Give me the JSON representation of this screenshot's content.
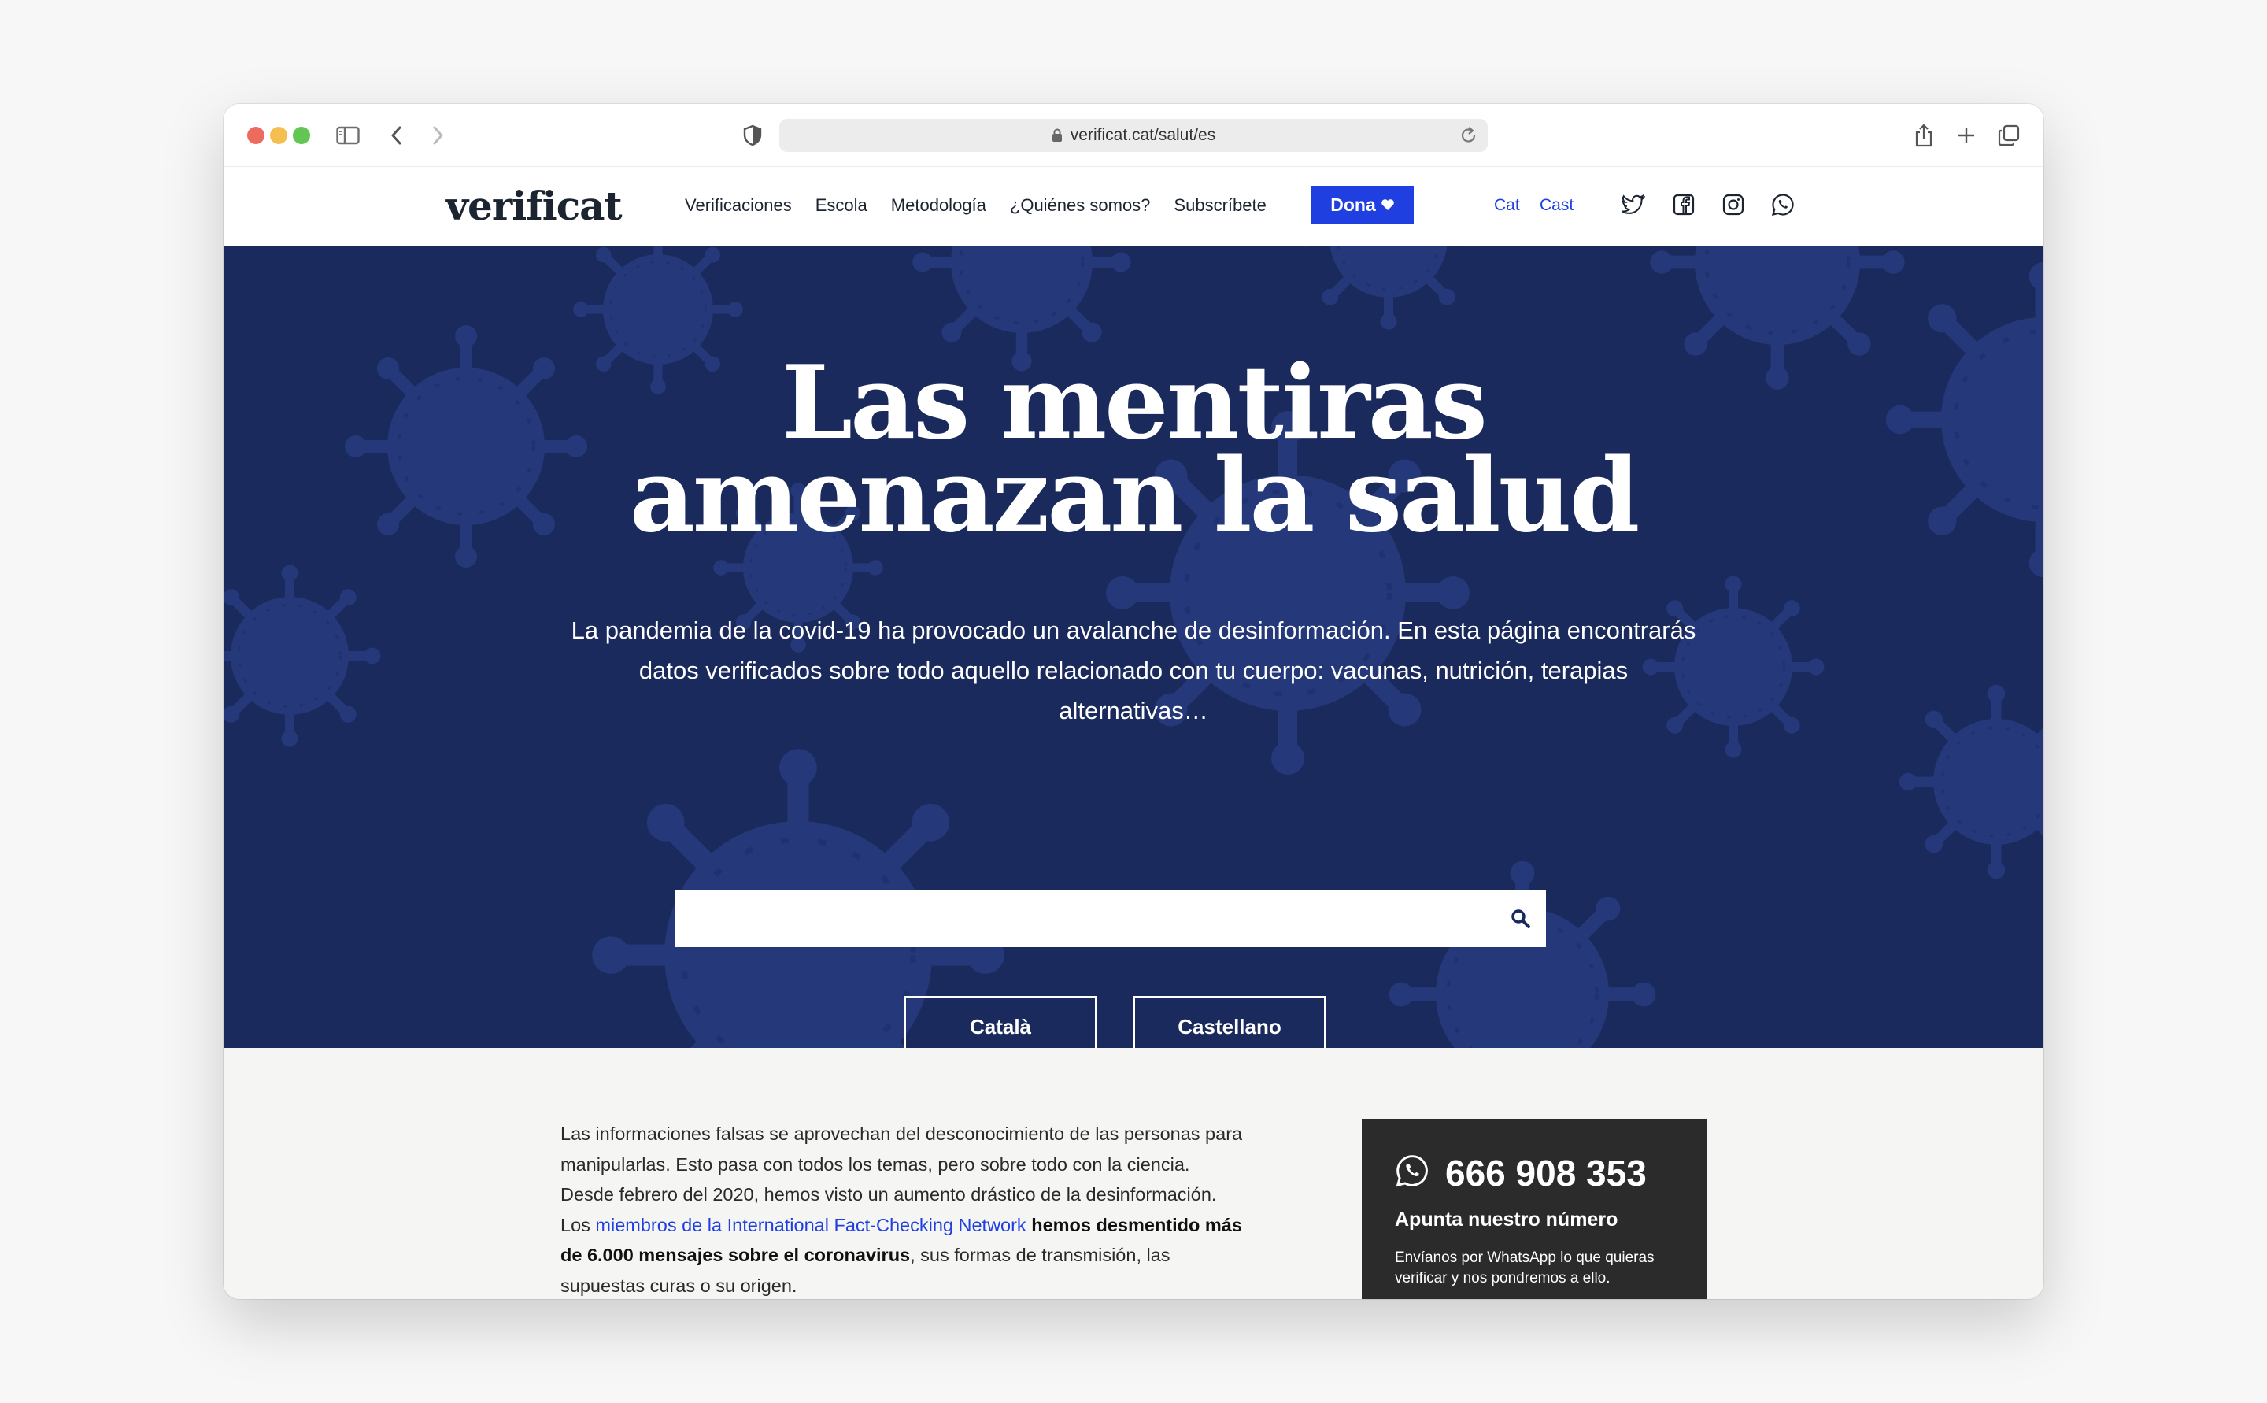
{
  "browser": {
    "url": "verificat.cat/salut/es"
  },
  "header": {
    "logo": "verificat",
    "nav": [
      "Verificaciones",
      "Escola",
      "Metodología",
      "¿Quiénes somos?",
      "Subscríbete"
    ],
    "donate_label": "Dona",
    "lang_cat": "Cat",
    "lang_cast": "Cast"
  },
  "hero": {
    "title_line1": "Las mentiras",
    "title_line2": "amenazan la salud",
    "subtitle": "La pandemia de la covid-19 ha provocado un avalanche de desinformación. En esta página encontrarás datos verificados sobre todo aquello relacionado con tu cuerpo: vacunas, nutrición, terapias alternativas…",
    "search_placeholder": "",
    "btn_catala": "Català",
    "btn_castellano": "Castellano"
  },
  "intro": {
    "text_a": "Las informaciones falsas se aprovechan del desconocimiento de las personas para manipularlas. Esto pasa con todos los temas, pero sobre todo con la ciencia. Desde febrero del 2020, hemos visto un aumento drástico de la desinformación. Los ",
    "link": "miembros de la International Fact-Checking Network",
    "text_b": " hemos desmentido más de 6.000 mensajes sobre el coronavirus",
    "text_c": ", sus formas de transmisión, las supuestas curas o su origen."
  },
  "whatsapp": {
    "number": "666 908 353",
    "title": "Apunta nuestro número",
    "text": "Envíanos por WhatsApp lo que quieras verificar y nos pondremos a ello."
  },
  "colors": {
    "brand_blue": "#1f3fe0",
    "hero_bg": "#1a2a5c",
    "virus": "#25397a"
  }
}
